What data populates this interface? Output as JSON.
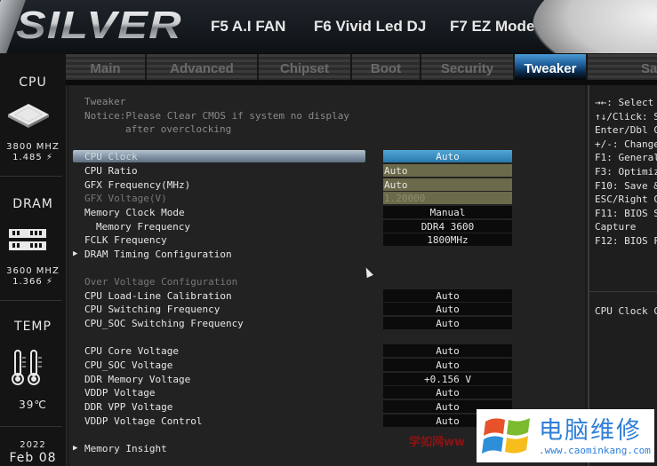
{
  "header": {
    "logo": "SILVER",
    "function_keys": [
      {
        "label": "F5 A.I FAN"
      },
      {
        "label": "F6 Vivid Led DJ"
      },
      {
        "label": "F7 EZ Mode"
      }
    ]
  },
  "sidebar": {
    "cpu": {
      "title": "CPU",
      "freq": "3800 MHZ",
      "volt": "1.485 ⚡",
      "icon": "cpu-chip-icon"
    },
    "dram": {
      "title": "DRAM",
      "freq": "3600 MHZ",
      "volt": "1.366 ⚡",
      "icon": "memory-module-icon"
    },
    "temp": {
      "title": "TEMP",
      "value": "39℃",
      "icon": "thermometer-icon"
    },
    "date": {
      "year": "2022",
      "day": "Feb 08"
    }
  },
  "tabs": [
    {
      "label": "Main",
      "active": false
    },
    {
      "label": "Advanced",
      "active": false
    },
    {
      "label": "Chipset",
      "active": false
    },
    {
      "label": "Boot",
      "active": false
    },
    {
      "label": "Security",
      "active": false
    },
    {
      "label": "Tweaker",
      "active": true
    },
    {
      "label": "Save",
      "active": false
    }
  ],
  "main": {
    "section_title": "Tweaker",
    "notice_line1": "Notice:Please Clear CMOS if system no display",
    "notice_line2": "after overclocking",
    "settings": [
      {
        "label": "CPU Clock",
        "value": "Auto",
        "selected": true
      },
      {
        "label": "CPU Ratio",
        "value": "Auto"
      },
      {
        "label": "GFX Frequency(MHz)",
        "value": "Auto"
      },
      {
        "label": "GFX Voltage(V)",
        "value": "1.20000",
        "disabled": true
      },
      {
        "label": "Memory Clock Mode",
        "value": "Manual"
      },
      {
        "label": "Memory Frequency",
        "value": "DDR4 3600"
      },
      {
        "label": "FCLK Frequency",
        "value": "1800MHz"
      },
      {
        "label": "DRAM Timing Configuration",
        "submenu": true
      }
    ],
    "voltage_section_title": "Over Voltage Configuration",
    "voltage_settings_a": [
      {
        "label": "CPU Load-Line Calibration",
        "value": "Auto"
      },
      {
        "label": "CPU Switching Frequency",
        "value": "Auto"
      },
      {
        "label": "CPU_SOC Switching Frequency",
        "value": "Auto"
      }
    ],
    "voltage_settings_b": [
      {
        "label": "CPU Core Voltage",
        "value": "Auto"
      },
      {
        "label": "CPU_SOC Voltage",
        "value": "Auto"
      },
      {
        "label": "DDR Memory Voltage",
        "value": "+0.156 V"
      },
      {
        "label": "VDDP Voltage",
        "value": "Auto"
      },
      {
        "label": "DDR VPP Voltage",
        "value": "Auto"
      },
      {
        "label": "VDDP Voltage Control",
        "value": "Auto"
      }
    ],
    "memory_insight": "Memory Insight"
  },
  "help_panel": {
    "lines": [
      "→←: Select",
      "↑↓/Click: S",
      "Enter/Dbl C",
      "+/-: Change",
      "F1: General",
      "F3: Optimiz",
      "F10: Save &",
      "ESC/Right C",
      "F11: BIOS S",
      "Capture",
      "F12: BIOS F"
    ],
    "description": "CPU Clock C"
  },
  "watermark": {
    "chinese": "电脑维修",
    "url": ".www.caominkang.com",
    "red_text": "学如网ww"
  }
}
